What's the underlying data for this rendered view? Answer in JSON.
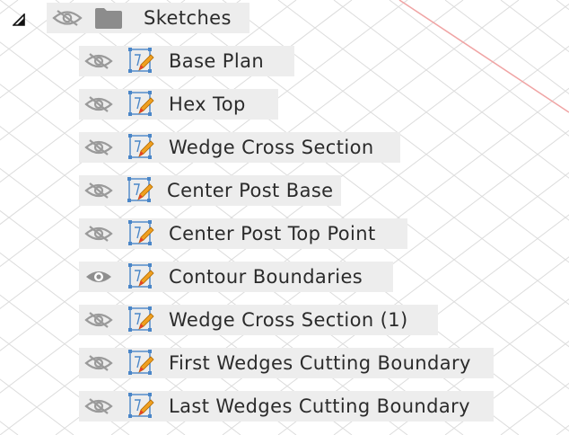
{
  "colors": {
    "row_background": "#ededed",
    "text": "#2b2b2b",
    "eye_icon": "#9a9a9a",
    "sketch_frame": "#4a86c8",
    "pencil_body": "#f0a020",
    "pencil_tip": "#e8402a",
    "grid_line": "#d9d9d9",
    "axis_line": "#f0a0a0"
  },
  "browser": {
    "collapse_icon": "triangle-expanded-icon",
    "folder": {
      "label": "Sketches",
      "visibility_icon": "eye-hidden-icon",
      "icon": "folder-icon",
      "visible": false
    },
    "sketches": [
      {
        "label": "Base Plan",
        "visible": false
      },
      {
        "label": "Hex Top",
        "visible": false
      },
      {
        "label": "Wedge Cross Section",
        "visible": false
      },
      {
        "label": "Center Post Base",
        "visible": false
      },
      {
        "label": "Center Post Top Point",
        "visible": false
      },
      {
        "label": "Contour Boundaries",
        "visible": true
      },
      {
        "label": "Wedge Cross Section (1)",
        "visible": false
      },
      {
        "label": "First Wedges Cutting Boundary",
        "visible": false
      },
      {
        "label": "Last Wedges Cutting Boundary",
        "visible": false
      }
    ]
  }
}
